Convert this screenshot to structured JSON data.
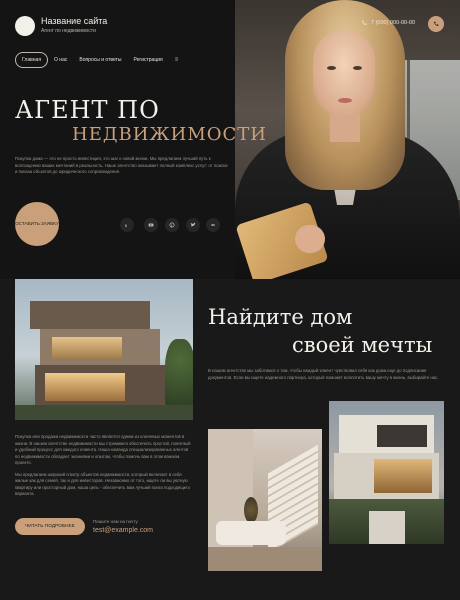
{
  "header": {
    "site_title": "Название сайта",
    "site_subtitle": "Агент по недвижимости",
    "phone": "7 (000) 000-00-00"
  },
  "nav": {
    "items": [
      "Главная",
      "О нас",
      "Вопросы и ответы",
      "Регистрация"
    ],
    "active_index": 0,
    "more": "≡"
  },
  "hero": {
    "headline_line1": "АГЕНТ ПО",
    "headline_line2": "НЕДВИЖИМОСТИ",
    "text": "Покупка дома — это не просто инвестиция, это шаг к новой жизни. Мы предлагаем лучший путь к воплощению ваших мечтаний в реальность. Наше агентство оказывает полный комплекс услуг: от поиска и показа объектов до юридического сопровождения.",
    "cta_label": "ОСТАВИТЬ ЗАЯВКУ",
    "social_icons": [
      "vk-icon",
      "youtube-icon",
      "pinterest-icon",
      "twitter-icon",
      "other-icon"
    ]
  },
  "section": {
    "heading_line1": "Найдите дом",
    "heading_line2": "своей мечты",
    "right_text": "В нашем агентстве мы заботимся о том, чтобы каждый клиент чувствовал себя как дома еще до подписания документов. Если вы ищете надежного партнера, который поможет воплотить вашу мечту в жизнь, выбирайте нас.",
    "left_paragraph_1": "Покупка или продажа недвижимости часто является одним из ключевых моментов в жизни. В нашем агентстве недвижимости мы стремимся обеспечить простой, понятный и удобный процесс для каждого клиента. Наша команда специализированных агентов по недвижимости обладает знаниями и опытом, чтобы помочь вам в этом важном проекте.",
    "left_paragraph_2": "Мы предлагаем широкий спектр объектов недвижимости, который включает в себя жилые как для семей, так и для инвесторов. Независимо от того, ищете ли вы уютную квартиру или просторный дом, наша цель - обеспечить вам лучший поиск подходящего варианта.",
    "more_button": "ЧИТАТЬ ПОДРОБНЕЕ",
    "mail_label": "Пишите нам на почту",
    "mail_value": "test@example.com"
  },
  "colors": {
    "accent": "#c9a07a",
    "background": "#1a1a1a",
    "text": "#e9e4dc"
  }
}
